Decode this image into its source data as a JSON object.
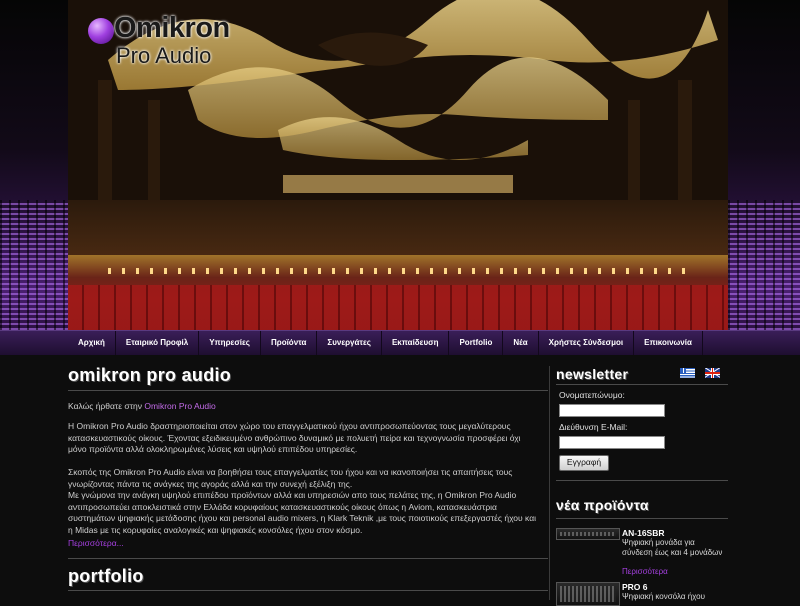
{
  "brand": {
    "name": "Omikron",
    "sub": "Pro Audio"
  },
  "nav": [
    "Αρχική",
    "Εταιρικό Προφίλ",
    "Υπηρεσίες",
    "Προϊόντα",
    "Συνεργάτες",
    "Εκπαίδευση",
    "Portfolio",
    "Νέα",
    "Χρήστες Σύνδεσμοι",
    "Επικοινωνία"
  ],
  "main": {
    "heading": "omikron pro audio",
    "welcome_prefix": "Καλώς ήρθατε στην ",
    "welcome_highlight": "Omikron Pro Audio",
    "para1": "Η Omikron Pro Audio δραστηριοποιείται στον χώρο του επαγγελματικού ήχου αντιπροσωπεύοντας τους μεγαλύτερους κατασκευαστικούς οίκους. Έχοντας εξειδικευμένο ανθρώπινο δυναμικό με πολυετή πείρα και τεχνογνωσία προσφέρει όχι μόνο προϊόντα αλλά ολοκληρωμένες λύσεις και υψηλού επιπέδου υπηρεσίες.",
    "para2": "Σκοπός της Omikron Pro Audio είναι να βοηθήσει τους επαγγελματίες του ήχου και να ικανοποιήσει τις απαιτήσεις τους γνωρίζοντας πάντα τις ανάγκες της αγοράς αλλά και την συνεχή εξέλιξη της.",
    "para3": "Με γνώμονα την ανάγκη υψηλού επιπέδου προϊόντων αλλά και υπηρεσιών απο τους πελάτες της, η Omikron Pro Audio αντιπροσωπεύει αποκλειστικά στην Ελλάδα κορυφαίους κατασκευαστικούς οίκους όπως η Aviom, κατασκευάστρια συστημάτων ψηφιακής μετάδοσης ήχου και personal audio mixers, η Klark Teknik ,με τους ποιοτικούς επεξεργαστές ήχου και η Midas με τις κορυφαίες αναλογικές και ψηφιακές κονσόλες ήχου στον κόσμο.",
    "more": "Περισσότερα...",
    "portfolio_heading": "portfolio"
  },
  "newsletter": {
    "heading": "newsletter",
    "name_label": "Ονοματεπώνυμο:",
    "name_value": "",
    "email_label": "Διεύθυνση E-Mail:",
    "email_value": "",
    "submit": "Εγγραφή"
  },
  "languages": [
    "greek-flag-icon",
    "uk-flag-icon"
  ],
  "new_products": {
    "heading": "νέα προϊόντα",
    "items": [
      {
        "title": "AN-16SBR",
        "desc": "Ψηφιακή μονάδα για σύνδεση έως και 4 μονάδων",
        "more": "Περισσότερα"
      },
      {
        "title": "PRO 6",
        "desc": "Ψηφιακή κονσόλα ήχου",
        "more": ""
      }
    ]
  },
  "colors": {
    "accent": "#a540e0",
    "nav": "#2e1748",
    "background": "#0d0d0d"
  }
}
